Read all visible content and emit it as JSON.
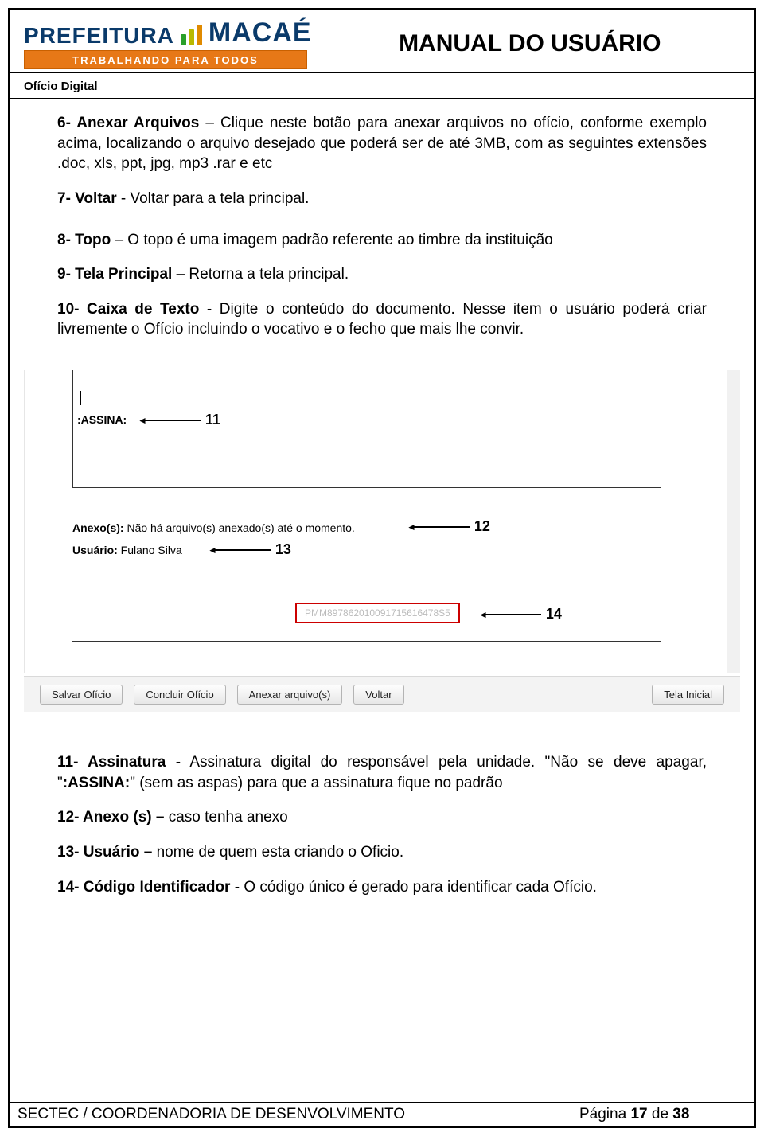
{
  "header": {
    "logo_prefeitura": "PREFEITURA",
    "logo_macae": "MACAÉ",
    "orange_bar": "TRABALHANDO PARA TODOS",
    "manual_title": "MANUAL DO USUÁRIO",
    "sub": "Ofício Digital"
  },
  "body": {
    "p6": "6- Anexar Arquivos – Clique neste botão para anexar arquivos no ofício, conforme exemplo acima, localizando o arquivo desejado que poderá ser de até 3MB, com as seguintes extensões .doc, xls, ppt, jpg, mp3 .rar e etc",
    "p6_bold": "6- Anexar Arquivos",
    "p7_bold": "7-  Voltar",
    "p7_rest": " - Voltar para a tela principal.",
    "p8_bold": "8-  Topo",
    "p8_rest": " – O topo é uma imagem padrão referente ao timbre da instituição",
    "p9_bold": "9-   Tela Principal",
    "p9_rest": " – Retorna a tela principal.",
    "p10_bold": "10- Caixa de Texto",
    "p10_rest": " - Digite o conteúdo do documento. Nesse item o usuário poderá criar livremente o Ofício incluindo o vocativo e o fecho que mais lhe convir.",
    "p11_bold": "11- Assinatura",
    "p11_rest_a": " - Assinatura digital do responsável pela unidade. \"Não se deve apagar, \"",
    "p11_assina": ":ASSINA:",
    "p11_rest_b": "\" (sem as aspas) para que a assinatura fique no padrão",
    "p12_bold": "12- Anexo (s) –",
    "p12_rest": " caso tenha anexo",
    "p13_bold": "13- Usuário –",
    "p13_rest": " nome de quem esta criando o Oficio.",
    "p14_bold": "14- Código Identificador",
    "p14_rest": " - O código único é gerado para identificar cada Ofício."
  },
  "screenshot": {
    "assina": ":ASSINA:",
    "anexo_label": "Anexo(s):",
    "anexo_text": " Não há arquivo(s) anexado(s) até o momento.",
    "usuario_label": "Usuário:",
    "usuario_text": " Fulano Silva",
    "codigo": "PMM897862010091715616478S5",
    "btn_salvar": "Salvar Ofício",
    "btn_concluir": "Concluir Ofício",
    "btn_anexar": "Anexar arquivo(s)",
    "btn_voltar": "Voltar",
    "btn_tela": "Tela Inicial",
    "n11": "11",
    "n12": "12",
    "n13": "13",
    "n14": "14"
  },
  "footer": {
    "left": "SECTEC / COORDENADORIA DE DESENVOLVIMENTO",
    "right_prefix": "Página ",
    "right_num": "17",
    "right_mid": " de ",
    "right_total": "38"
  }
}
